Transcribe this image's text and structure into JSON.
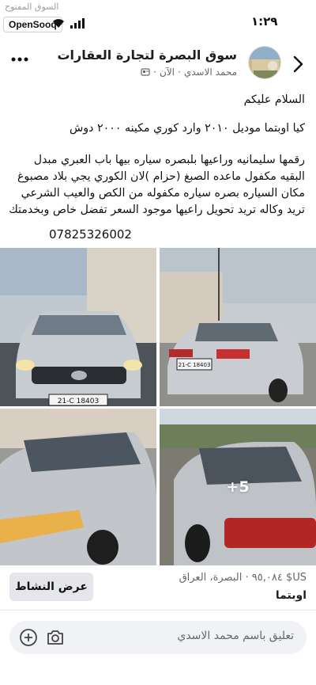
{
  "status_bar": {
    "watermark": "السوق المفتوح",
    "app_badge": "OpenSooq",
    "time": "١:٢٩"
  },
  "header": {
    "page_name": "سوق البصرة لتجارة العقارات",
    "author": "محمد الاسدي",
    "time_ago": "الآن"
  },
  "post": {
    "greeting": "السلام عليكم",
    "title": "كيا اوبتما موديل ٢٠١٠ وارد كوري مكينه ٢٠٠٠ دوش",
    "body": "رقمها سليمانيه وراعيها بلبصره سياره بيها باب العبري مبدل البقيه مكفول ماعده الصبغ (حزام )لان الكوري يجي بلاد مصبوغ مكان السياره بصره سياره مكفوله من الكص والعيب الشرعي تريد وكاله تريد تحويل راعيها موجود السعر تفضل خاص وبخدمتك",
    "phone": "07825326002"
  },
  "photos": {
    "more_count": "+5",
    "plate_front": "21-C 18403",
    "plate_rear": "21-C 18403"
  },
  "listing": {
    "activity_button": "عرض النشاط",
    "price_location": "US$ ٩٥,٠٨٤ · البصرة، العراق",
    "item_name": "اوبتما"
  },
  "comment": {
    "placeholder": "تعليق باسم محمد الاسدي"
  }
}
